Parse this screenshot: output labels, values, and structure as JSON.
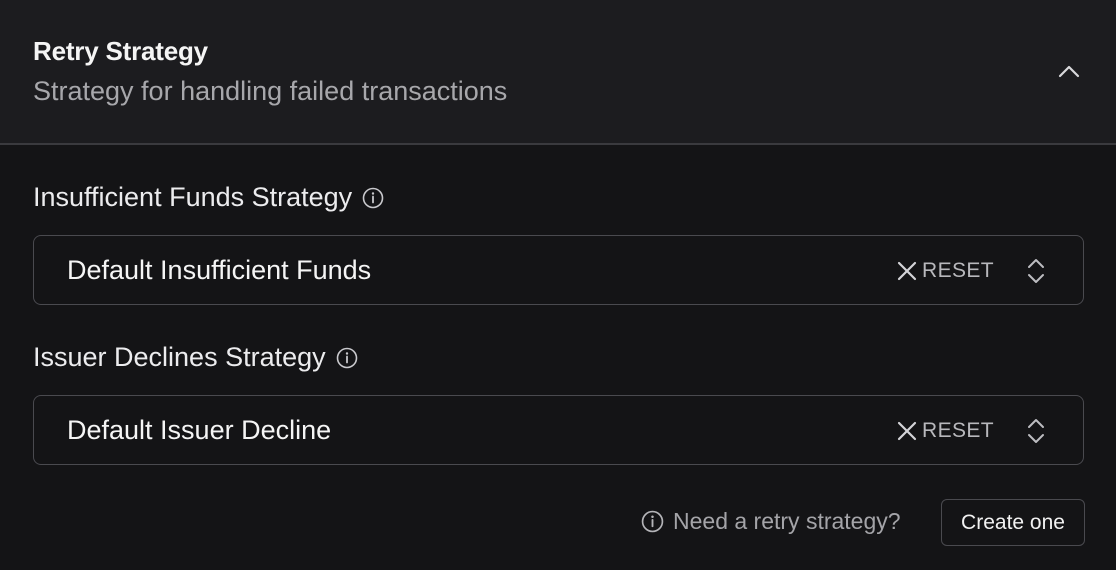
{
  "section": {
    "title": "Retry Strategy",
    "subtitle": "Strategy for handling failed transactions",
    "collapse_icon": "chevron-up-icon"
  },
  "fields": [
    {
      "label": "Insufficient Funds Strategy",
      "info_icon": "info-icon",
      "value": "Default Insufficient Funds",
      "reset_label": "RESET",
      "clear_icon": "close-icon",
      "toggle_icon": "chevron-up-down-icon"
    },
    {
      "label": "Issuer Declines Strategy",
      "info_icon": "info-icon",
      "value": "Default Issuer Decline",
      "reset_label": "RESET",
      "clear_icon": "close-icon",
      "toggle_icon": "chevron-up-down-icon"
    }
  ],
  "footer": {
    "help_text": "Need a retry strategy?",
    "create_label": "Create one",
    "help_icon": "info-icon"
  },
  "colors": {
    "background": "#141416",
    "header_background": "#1c1c1f",
    "border": "#4a4a4f",
    "muted_text": "#a7a7ab"
  }
}
